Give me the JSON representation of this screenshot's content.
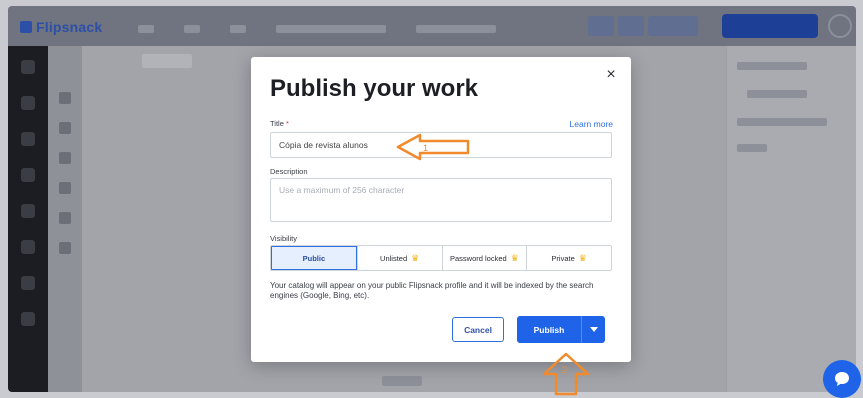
{
  "background_app": {
    "brand": "Flipsnack"
  },
  "modal": {
    "title": "Publish your work",
    "close_glyph": "×",
    "title_field": {
      "label": "Title",
      "required_mark": "*",
      "learn_more": "Learn more",
      "value": "Cópia de revista alunos"
    },
    "description_field": {
      "label": "Description",
      "placeholder": "Use a maximum of 256 character"
    },
    "visibility": {
      "label": "Visibility",
      "options": [
        {
          "label": "Public",
          "selected": true,
          "premium": false
        },
        {
          "label": "Unlisted",
          "selected": false,
          "premium": true
        },
        {
          "label": "Password locked",
          "selected": false,
          "premium": true
        },
        {
          "label": "Private",
          "selected": false,
          "premium": true
        }
      ],
      "note": "Your catalog will appear on your public Flipsnack profile and it will be indexed by the search engines (Google, Bing, etc)."
    },
    "cancel_label": "Cancel",
    "publish_label": "Publish"
  },
  "annotations": {
    "arrow1_number": "1",
    "arrow2_number": "2",
    "color": "#f08a2c"
  },
  "colors": {
    "accent": "#1f63e8",
    "link": "#2f6fdf",
    "premium_crown": "#f2b21a"
  },
  "icons": {
    "close": "close-icon",
    "crown": "crown-icon",
    "dropdown": "chevron-down-icon",
    "chat": "chat-icon"
  }
}
